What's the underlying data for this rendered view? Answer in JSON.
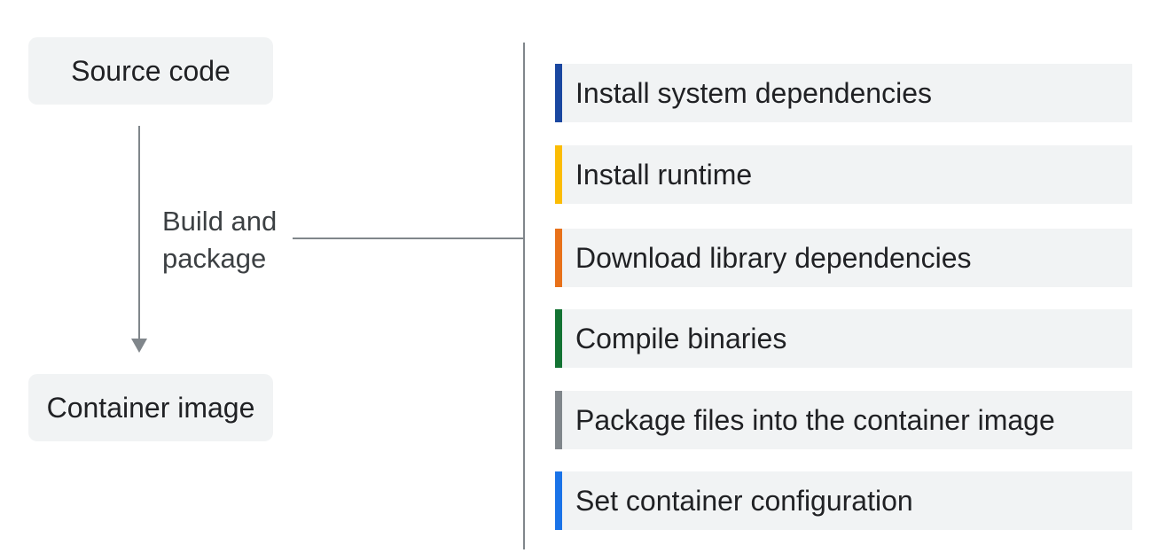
{
  "nodes": {
    "source": "Source code",
    "container": "Container image"
  },
  "edge_label": {
    "line1": "Build and",
    "line2": "package"
  },
  "steps": [
    {
      "label": "Install system dependencies",
      "color": "#1a47a0"
    },
    {
      "label": "Install runtime",
      "color": "#fbbc04"
    },
    {
      "label": "Download library dependencies",
      "color": "#e8711a"
    },
    {
      "label": "Compile binaries",
      "color": "#137333"
    },
    {
      "label": "Package files into the container image",
      "color": "#80868b"
    },
    {
      "label": "Set container configuration",
      "color": "#1a73e8"
    }
  ]
}
